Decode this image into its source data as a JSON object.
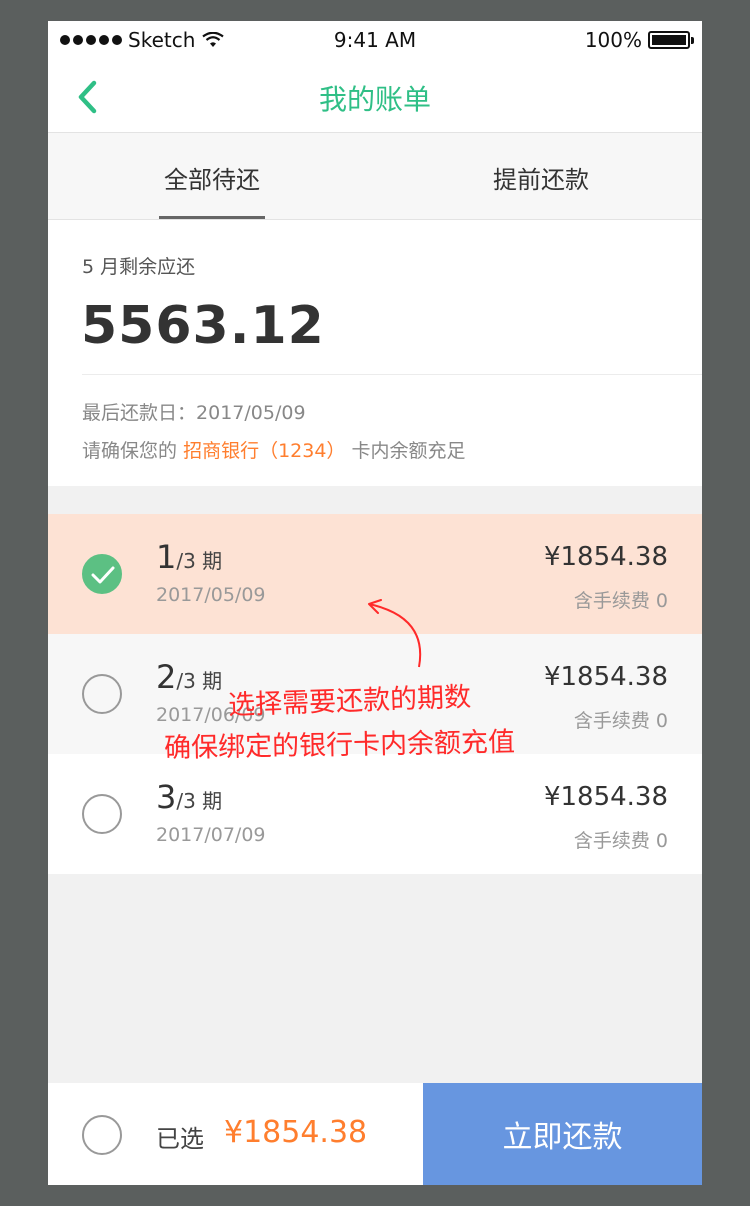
{
  "status_bar": {
    "carrier": "Sketch",
    "time": "9:41 AM",
    "battery": "100%"
  },
  "nav": {
    "title": "我的账单",
    "back_icon": "chevron-left-icon"
  },
  "tabs": [
    {
      "label": "全部待还",
      "active": true
    },
    {
      "label": "提前还款",
      "active": false
    }
  ],
  "summary": {
    "label": "5 月剩余应还",
    "amount": "5563.12",
    "due_label": "最后还款日",
    "due_sep": "：",
    "due_date": "2017/05/09",
    "bank_prefix": "请确保您的",
    "bank_name": "招商银行（1234）",
    "bank_suffix": "卡内余额充足"
  },
  "installments": [
    {
      "num": "1",
      "total": "/3 期",
      "date": "2017/05/09",
      "amount": "¥1854.38",
      "fee": "含手续费 0",
      "selected": true
    },
    {
      "num": "2",
      "total": "/3 期",
      "date": "2017/06/09",
      "amount": "¥1854.38",
      "fee": "含手续费 0",
      "selected": false
    },
    {
      "num": "3",
      "total": "/3 期",
      "date": "2017/07/09",
      "amount": "¥1854.38",
      "fee": "含手续费 0",
      "selected": false
    }
  ],
  "annotation": {
    "line1": "选择需要还款的期数",
    "line2": "确保绑定的银行卡内余额充值"
  },
  "footer": {
    "selected_label": "已选",
    "selected_amount": "¥1854.38",
    "pay_button": "立即还款"
  },
  "colors": {
    "brand_green": "#2fbf86",
    "accent_orange": "#ff7e2e",
    "selected_row": "#fde2d4",
    "pay_button": "#6796e0",
    "annotation_red": "#ff2a2a"
  }
}
